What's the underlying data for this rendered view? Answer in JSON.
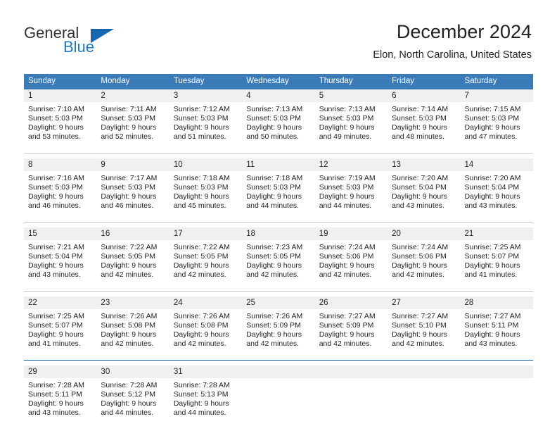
{
  "brand": {
    "line1": "General",
    "line2": "Blue",
    "flag_icon": "triangle-flag-icon",
    "accent_color": "#1667b1",
    "text_color": "#333333"
  },
  "header": {
    "title": "December 2024",
    "subtitle": "Elon, North Carolina, United States"
  },
  "calendar": {
    "header_bg": "#3b7cb8",
    "header_text_color": "#ffffff",
    "daynum_bg": "#f0f0f0",
    "separator_color": "#c8c8c8",
    "separator_accent_color": "#1667b1",
    "weekdays": [
      "Sunday",
      "Monday",
      "Tuesday",
      "Wednesday",
      "Thursday",
      "Friday",
      "Saturday"
    ],
    "weeks": [
      [
        {
          "day": "1",
          "sunrise": "Sunrise: 7:10 AM",
          "sunset": "Sunset: 5:03 PM",
          "daylight1": "Daylight: 9 hours",
          "daylight2": "and 53 minutes."
        },
        {
          "day": "2",
          "sunrise": "Sunrise: 7:11 AM",
          "sunset": "Sunset: 5:03 PM",
          "daylight1": "Daylight: 9 hours",
          "daylight2": "and 52 minutes."
        },
        {
          "day": "3",
          "sunrise": "Sunrise: 7:12 AM",
          "sunset": "Sunset: 5:03 PM",
          "daylight1": "Daylight: 9 hours",
          "daylight2": "and 51 minutes."
        },
        {
          "day": "4",
          "sunrise": "Sunrise: 7:13 AM",
          "sunset": "Sunset: 5:03 PM",
          "daylight1": "Daylight: 9 hours",
          "daylight2": "and 50 minutes."
        },
        {
          "day": "5",
          "sunrise": "Sunrise: 7:13 AM",
          "sunset": "Sunset: 5:03 PM",
          "daylight1": "Daylight: 9 hours",
          "daylight2": "and 49 minutes."
        },
        {
          "day": "6",
          "sunrise": "Sunrise: 7:14 AM",
          "sunset": "Sunset: 5:03 PM",
          "daylight1": "Daylight: 9 hours",
          "daylight2": "and 48 minutes."
        },
        {
          "day": "7",
          "sunrise": "Sunrise: 7:15 AM",
          "sunset": "Sunset: 5:03 PM",
          "daylight1": "Daylight: 9 hours",
          "daylight2": "and 47 minutes."
        }
      ],
      [
        {
          "day": "8",
          "sunrise": "Sunrise: 7:16 AM",
          "sunset": "Sunset: 5:03 PM",
          "daylight1": "Daylight: 9 hours",
          "daylight2": "and 46 minutes."
        },
        {
          "day": "9",
          "sunrise": "Sunrise: 7:17 AM",
          "sunset": "Sunset: 5:03 PM",
          "daylight1": "Daylight: 9 hours",
          "daylight2": "and 46 minutes."
        },
        {
          "day": "10",
          "sunrise": "Sunrise: 7:18 AM",
          "sunset": "Sunset: 5:03 PM",
          "daylight1": "Daylight: 9 hours",
          "daylight2": "and 45 minutes."
        },
        {
          "day": "11",
          "sunrise": "Sunrise: 7:18 AM",
          "sunset": "Sunset: 5:03 PM",
          "daylight1": "Daylight: 9 hours",
          "daylight2": "and 44 minutes."
        },
        {
          "day": "12",
          "sunrise": "Sunrise: 7:19 AM",
          "sunset": "Sunset: 5:03 PM",
          "daylight1": "Daylight: 9 hours",
          "daylight2": "and 44 minutes."
        },
        {
          "day": "13",
          "sunrise": "Sunrise: 7:20 AM",
          "sunset": "Sunset: 5:04 PM",
          "daylight1": "Daylight: 9 hours",
          "daylight2": "and 43 minutes."
        },
        {
          "day": "14",
          "sunrise": "Sunrise: 7:20 AM",
          "sunset": "Sunset: 5:04 PM",
          "daylight1": "Daylight: 9 hours",
          "daylight2": "and 43 minutes."
        }
      ],
      [
        {
          "day": "15",
          "sunrise": "Sunrise: 7:21 AM",
          "sunset": "Sunset: 5:04 PM",
          "daylight1": "Daylight: 9 hours",
          "daylight2": "and 43 minutes."
        },
        {
          "day": "16",
          "sunrise": "Sunrise: 7:22 AM",
          "sunset": "Sunset: 5:05 PM",
          "daylight1": "Daylight: 9 hours",
          "daylight2": "and 42 minutes."
        },
        {
          "day": "17",
          "sunrise": "Sunrise: 7:22 AM",
          "sunset": "Sunset: 5:05 PM",
          "daylight1": "Daylight: 9 hours",
          "daylight2": "and 42 minutes."
        },
        {
          "day": "18",
          "sunrise": "Sunrise: 7:23 AM",
          "sunset": "Sunset: 5:05 PM",
          "daylight1": "Daylight: 9 hours",
          "daylight2": "and 42 minutes."
        },
        {
          "day": "19",
          "sunrise": "Sunrise: 7:24 AM",
          "sunset": "Sunset: 5:06 PM",
          "daylight1": "Daylight: 9 hours",
          "daylight2": "and 42 minutes."
        },
        {
          "day": "20",
          "sunrise": "Sunrise: 7:24 AM",
          "sunset": "Sunset: 5:06 PM",
          "daylight1": "Daylight: 9 hours",
          "daylight2": "and 42 minutes."
        },
        {
          "day": "21",
          "sunrise": "Sunrise: 7:25 AM",
          "sunset": "Sunset: 5:07 PM",
          "daylight1": "Daylight: 9 hours",
          "daylight2": "and 41 minutes."
        }
      ],
      [
        {
          "day": "22",
          "sunrise": "Sunrise: 7:25 AM",
          "sunset": "Sunset: 5:07 PM",
          "daylight1": "Daylight: 9 hours",
          "daylight2": "and 41 minutes."
        },
        {
          "day": "23",
          "sunrise": "Sunrise: 7:26 AM",
          "sunset": "Sunset: 5:08 PM",
          "daylight1": "Daylight: 9 hours",
          "daylight2": "and 42 minutes."
        },
        {
          "day": "24",
          "sunrise": "Sunrise: 7:26 AM",
          "sunset": "Sunset: 5:08 PM",
          "daylight1": "Daylight: 9 hours",
          "daylight2": "and 42 minutes."
        },
        {
          "day": "25",
          "sunrise": "Sunrise: 7:26 AM",
          "sunset": "Sunset: 5:09 PM",
          "daylight1": "Daylight: 9 hours",
          "daylight2": "and 42 minutes."
        },
        {
          "day": "26",
          "sunrise": "Sunrise: 7:27 AM",
          "sunset": "Sunset: 5:09 PM",
          "daylight1": "Daylight: 9 hours",
          "daylight2": "and 42 minutes."
        },
        {
          "day": "27",
          "sunrise": "Sunrise: 7:27 AM",
          "sunset": "Sunset: 5:10 PM",
          "daylight1": "Daylight: 9 hours",
          "daylight2": "and 42 minutes."
        },
        {
          "day": "28",
          "sunrise": "Sunrise: 7:27 AM",
          "sunset": "Sunset: 5:11 PM",
          "daylight1": "Daylight: 9 hours",
          "daylight2": "and 43 minutes."
        }
      ],
      [
        {
          "day": "29",
          "sunrise": "Sunrise: 7:28 AM",
          "sunset": "Sunset: 5:11 PM",
          "daylight1": "Daylight: 9 hours",
          "daylight2": "and 43 minutes."
        },
        {
          "day": "30",
          "sunrise": "Sunrise: 7:28 AM",
          "sunset": "Sunset: 5:12 PM",
          "daylight1": "Daylight: 9 hours",
          "daylight2": "and 44 minutes."
        },
        {
          "day": "31",
          "sunrise": "Sunrise: 7:28 AM",
          "sunset": "Sunset: 5:13 PM",
          "daylight1": "Daylight: 9 hours",
          "daylight2": "and 44 minutes."
        },
        {
          "day": "",
          "sunrise": "",
          "sunset": "",
          "daylight1": "",
          "daylight2": ""
        },
        {
          "day": "",
          "sunrise": "",
          "sunset": "",
          "daylight1": "",
          "daylight2": ""
        },
        {
          "day": "",
          "sunrise": "",
          "sunset": "",
          "daylight1": "",
          "daylight2": ""
        },
        {
          "day": "",
          "sunrise": "",
          "sunset": "",
          "daylight1": "",
          "daylight2": ""
        }
      ]
    ]
  }
}
